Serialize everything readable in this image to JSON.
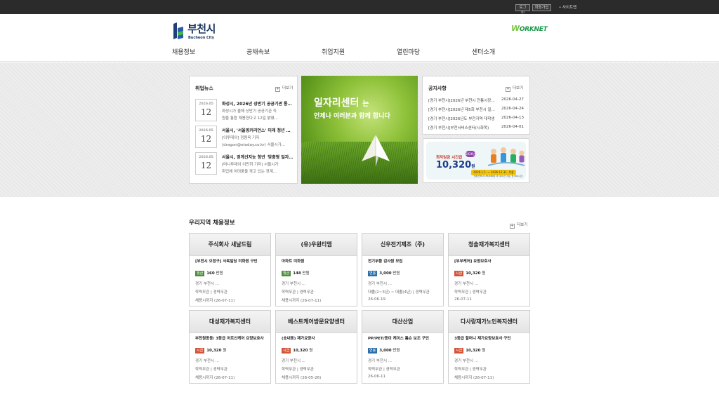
{
  "topbar": {
    "login": "로그인",
    "join": "회원가입",
    "sitemap": "• 사이트맵"
  },
  "logo": {
    "ko": "부천시",
    "en": "Bucheon City"
  },
  "worknet": "WORKNET",
  "nav": [
    "채용정보",
    "공채속보",
    "취업지원",
    "열린마당",
    "센터소개"
  ],
  "news": {
    "title": "취업뉴스",
    "more": "더보기",
    "items": [
      {
        "ym": "2026.05",
        "day": "12",
        "title": "화성시, 2026년 상반기 공공기관 통합채용",
        "body": [
          "화성시가 올해 상반기 공공기관 직",
          "원을 통합 채용한다고 12일 밝혔..."
        ]
      },
      {
        "ym": "2026.05",
        "day": "12",
        "title": "서울시, '서울영커리언스' 미래 청년 인재",
        "body": [
          "[이투데이] 정용욱 기자",
          "(dragon@etoday.co.kr) 서울시가..."
        ]
      },
      {
        "ym": "2026.05",
        "day": "12",
        "title": "서울시, 경계선지능 청년 '맞춤형 일자리'",
        "body": [
          "[머니투데이 이민하 기자] 서울시가",
          "취업에 어려움을 겪고 있는 경계..."
        ]
      }
    ]
  },
  "hero": {
    "line1": "일자리센터",
    "line1_suffix": "는",
    "line2": "언제나 여러분과 함께 합니다"
  },
  "notice": {
    "title": "공지사항",
    "more": "더보기",
    "items": [
      {
        "title": "[경기 부천시]2026년 부천시 전통시장 청년몰",
        "date": "2026-04-27"
      },
      {
        "title": "[경기 부천시]2026년 제5회 부천시 일자리",
        "date": "2026-04-24"
      },
      {
        "title": "[경기 부천시]2026년도 부천지역 대학생",
        "date": "2026-04-13"
      },
      {
        "title": "[경기 부천시]부천서비스센터(시화목)",
        "date": "2026-04-01"
      }
    ]
  },
  "wage_banner": {
    "label": "최저임금 시간급",
    "amount": "10,320",
    "unit": "원",
    "year": "2026년",
    "period": "2026.1.1. ~ 2026.12.31. 적용",
    "foot": "월환산액 2,156,880원 (주 40시간 기준, 월 209시간)"
  },
  "jobs": {
    "title": "우리지역 채용정보",
    "more": "더보기",
    "items": [
      {
        "company": "주식회사 새날드림",
        "title": "[부천시 오정구] 사옥빌딩 미화원 구인",
        "pay_type": "월급",
        "pay_color": "#4a8e3a",
        "pay": "160",
        "pay_unit": "만원",
        "loc": "경기 부천시 ...",
        "cond": "학력무관 | 경력무관",
        "deadline": "채용시까지 (26-07-11)"
      },
      {
        "company": "(유)우원티엠",
        "title": "아파트 미화원",
        "pay_type": "월급",
        "pay_color": "#4a8e3a",
        "pay": "148",
        "pay_unit": "만원",
        "loc": "경기 부천시 ...",
        "cond": "학력무관 | 경력무관",
        "deadline": "채용시까지 (26-07-11)"
      },
      {
        "company": "신우전기제조（주)",
        "title": "전기부품 검사원 모집",
        "pay_type": "연봉",
        "pay_color": "#2d6fa8",
        "pay": "3,000",
        "pay_unit": "만원",
        "loc": "경기 부천시 ...",
        "cond": "대졸(2~3년) ~ 대졸(4년) | 경력무관",
        "deadline": "26-06-19"
      },
      {
        "company": "청솔재가복지센터",
        "title": "[부부케어] 요양보호사",
        "pay_type": "시급",
        "pay_color": "#d2553a",
        "pay": "10,320",
        "pay_unit": "원",
        "loc": "경기 부천시 ...",
        "cond": "학력무관 | 경력무관",
        "deadline": "26-07-11"
      },
      {
        "company": "대성재가복지센터",
        "title": "부천원종동/ 3등급 어르신케어 요양보호사",
        "pay_type": "시급",
        "pay_color": "#d2553a",
        "pay": "10,320",
        "pay_unit": "원",
        "loc": "경기 부천시 ...",
        "cond": "학력무관 | 경력무관",
        "deadline": "채용시까지 (26-07-11)"
      },
      {
        "company": "베스트케어방문요양센터",
        "title": "(송내동) 재가요양사",
        "pay_type": "시급",
        "pay_color": "#d2553a",
        "pay": "10,320",
        "pay_unit": "원",
        "loc": "경기 부천시 ...",
        "cond": "학력무관 | 경력무관",
        "deadline": "채용시까지 (26-05-26)"
      },
      {
        "company": "대산산업",
        "title": "PP/PET/종이 케이스 톰슨 보조 구인",
        "pay_type": "연봉",
        "pay_color": "#2d6fa8",
        "pay": "3,000",
        "pay_unit": "만원",
        "loc": "경기 부천시 ...",
        "cond": "학력무관 | 경력무관",
        "deadline": "26-06-11"
      },
      {
        "company": "다사랑재가노인복지센터",
        "title": "3등급 할머니 재가요양보호사 구인",
        "pay_type": "시급",
        "pay_color": "#d2553a",
        "pay": "10,320",
        "pay_unit": "원",
        "loc": "경기 부천시 ...",
        "cond": "학력무관 | 경력무관",
        "deadline": "채용시까지 (26-07-11)"
      }
    ]
  }
}
